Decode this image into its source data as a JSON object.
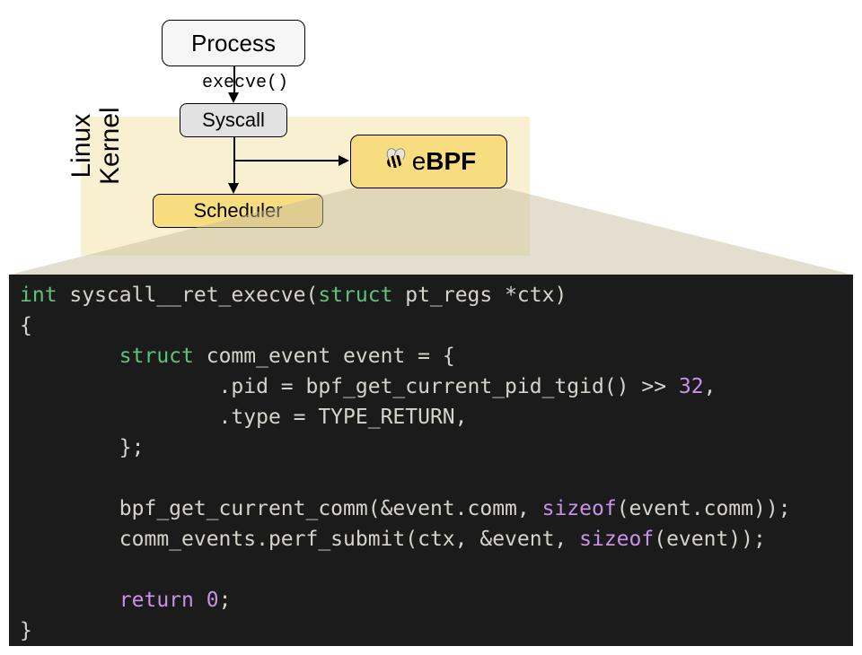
{
  "diagram": {
    "kernel_label": "Linux\nKernel",
    "kernel_bg": "#f9f0d2",
    "box_default_bg": "#f7dd80",
    "process_label": "Process",
    "syscall_label": "Syscall",
    "scheduler_label": "Scheduler",
    "ebpf_e": "e",
    "ebpf_bpf": "BPF",
    "execve_label": "execve()"
  },
  "arrows": {
    "process_to_syscall": true,
    "syscall_to_scheduler": true,
    "syscall_to_ebpf": true
  },
  "code_tokens": [
    [
      {
        "t": "int ",
        "c": "tok-type"
      },
      {
        "t": "syscall__ret_execve",
        "c": "tok-ident"
      },
      {
        "t": "(",
        "c": "tok-punc"
      },
      {
        "t": "struct",
        "c": "tok-type"
      },
      {
        "t": " pt_regs *ctx)",
        "c": "tok-ident"
      }
    ],
    [
      {
        "t": "{",
        "c": "tok-punc"
      }
    ],
    [
      {
        "t": "        ",
        "c": ""
      },
      {
        "t": "struct",
        "c": "tok-type"
      },
      {
        "t": " comm_event event = {",
        "c": "tok-ident"
      }
    ],
    [
      {
        "t": "                .pid = bpf_get_current_pid_tgid() >> ",
        "c": "tok-ident"
      },
      {
        "t": "32",
        "c": "tok-num"
      },
      {
        "t": ",",
        "c": "tok-punc"
      }
    ],
    [
      {
        "t": "                .type = TYPE_RETURN,",
        "c": "tok-ident"
      }
    ],
    [
      {
        "t": "        };",
        "c": "tok-ident"
      }
    ],
    [
      {
        "t": "",
        "c": ""
      }
    ],
    [
      {
        "t": "        bpf_get_current_comm(&event.comm, ",
        "c": "tok-ident"
      },
      {
        "t": "sizeof",
        "c": "tok-kw"
      },
      {
        "t": "(event.comm));",
        "c": "tok-ident"
      }
    ],
    [
      {
        "t": "        comm_events.perf_submit(ctx, &event, ",
        "c": "tok-ident"
      },
      {
        "t": "sizeof",
        "c": "tok-kw"
      },
      {
        "t": "(event));",
        "c": "tok-ident"
      }
    ],
    [
      {
        "t": "",
        "c": ""
      }
    ],
    [
      {
        "t": "        ",
        "c": ""
      },
      {
        "t": "return ",
        "c": "tok-kw"
      },
      {
        "t": "0",
        "c": "tok-num"
      },
      {
        "t": ";",
        "c": "tok-punc"
      }
    ],
    [
      {
        "t": "}",
        "c": "tok-punc"
      }
    ]
  ]
}
